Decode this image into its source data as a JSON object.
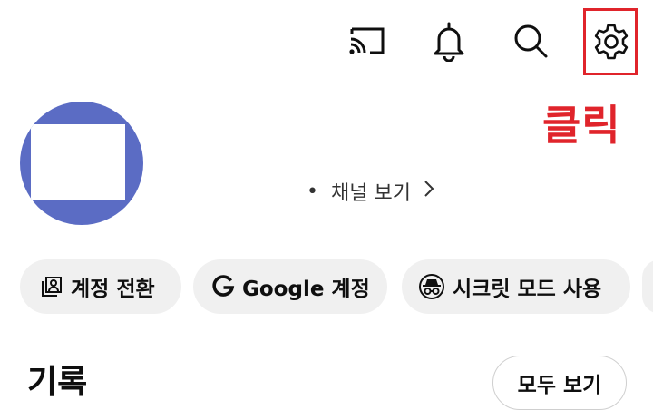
{
  "topbar": {
    "cast_icon": "cast-icon",
    "notifications_icon": "bell-icon",
    "search_icon": "search-icon",
    "settings_icon": "gear-icon",
    "highlight_color": "#e0242b"
  },
  "annotation": {
    "label": "클릭",
    "color": "#e0242b"
  },
  "profile": {
    "avatar_color": "#5b6cc4",
    "channel_link_bullet": "•",
    "channel_link_label": "채널 보기"
  },
  "chips": [
    {
      "icon": "account-switch-icon",
      "label": "계정 전환"
    },
    {
      "icon": "google-g-icon",
      "label": "Google 계정"
    },
    {
      "icon": "incognito-icon",
      "label": "시크릿 모드 사용"
    }
  ],
  "history": {
    "title": "기록",
    "view_all_label": "모두 보기"
  }
}
